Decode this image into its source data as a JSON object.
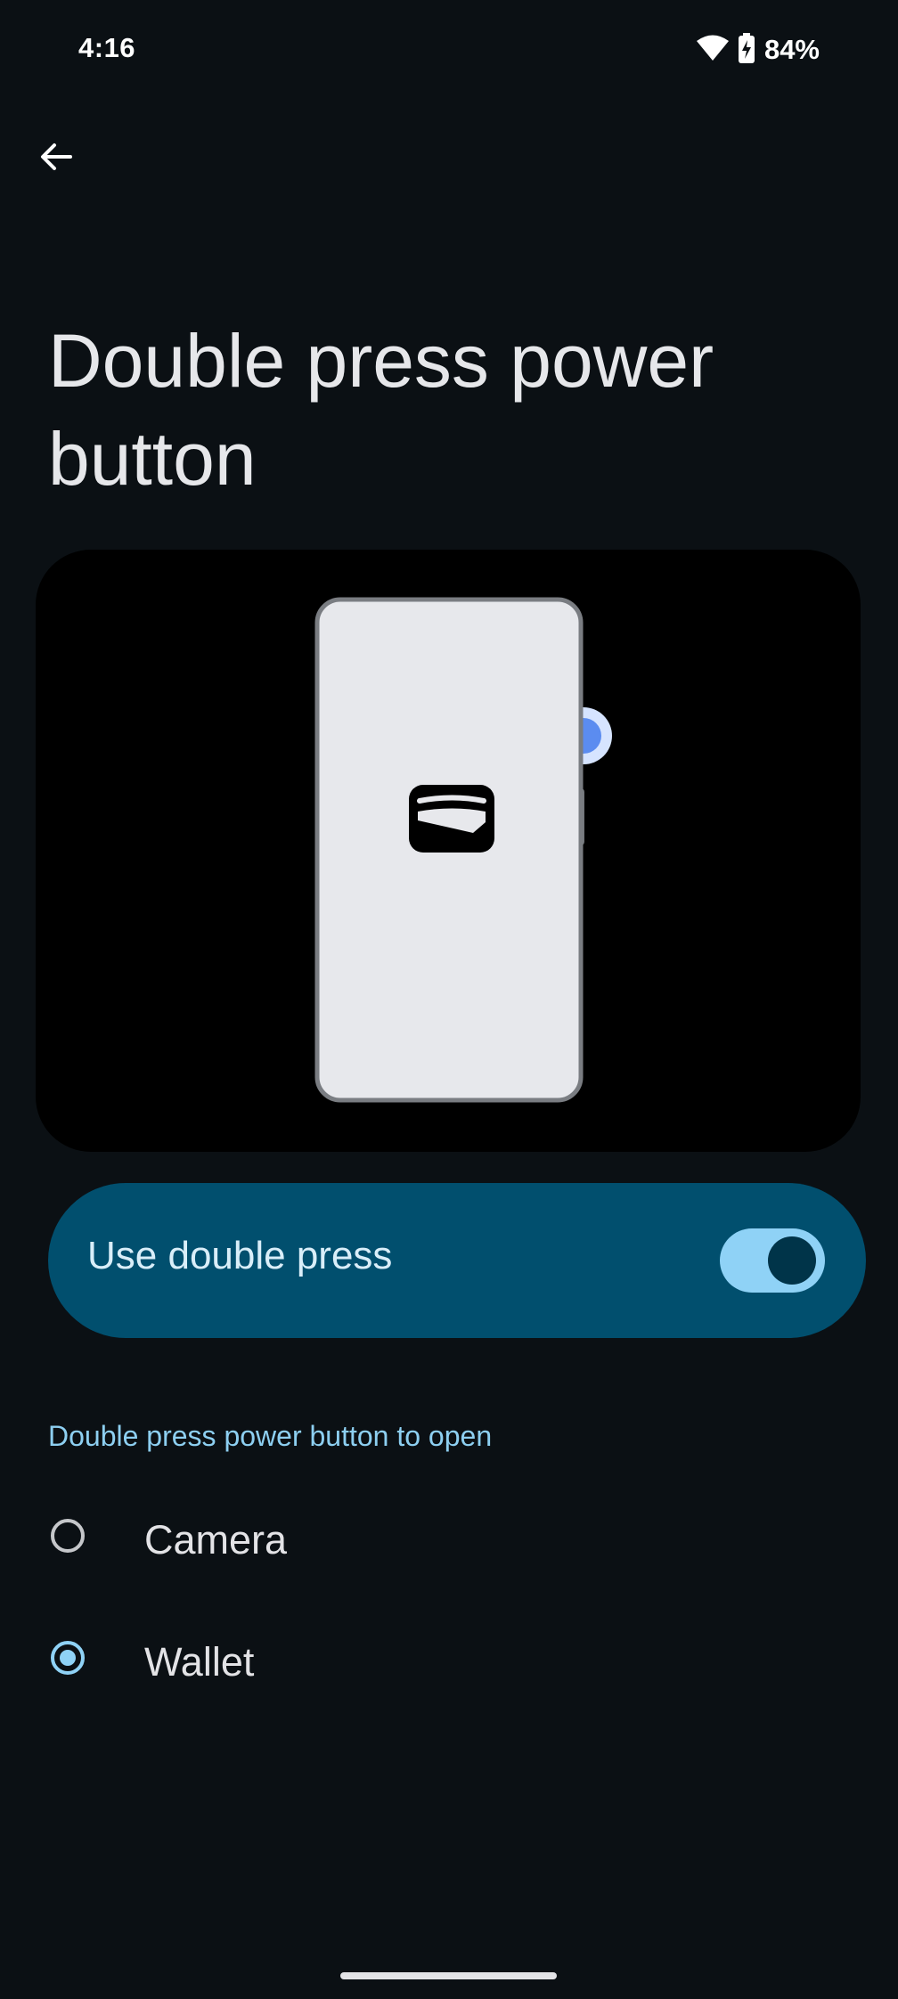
{
  "status_bar": {
    "time": "4:16",
    "battery_percent": "84%",
    "wifi_icon": "wifi-icon",
    "battery_icon": "battery-charging-icon"
  },
  "app_bar": {
    "back_icon": "arrow-back-icon"
  },
  "page": {
    "title": "Double press power button"
  },
  "illustration": {
    "app_icon": "wallet-icon"
  },
  "toggle": {
    "label": "Use double press",
    "checked": true
  },
  "section": {
    "header": "Double press power button to open"
  },
  "options": [
    {
      "label": "Camera",
      "selected": false
    },
    {
      "label": "Wallet",
      "selected": true
    }
  ],
  "colors": {
    "accent": "#8fd2f6",
    "toggle_card": "#014f6e",
    "background": "#0b1014"
  }
}
